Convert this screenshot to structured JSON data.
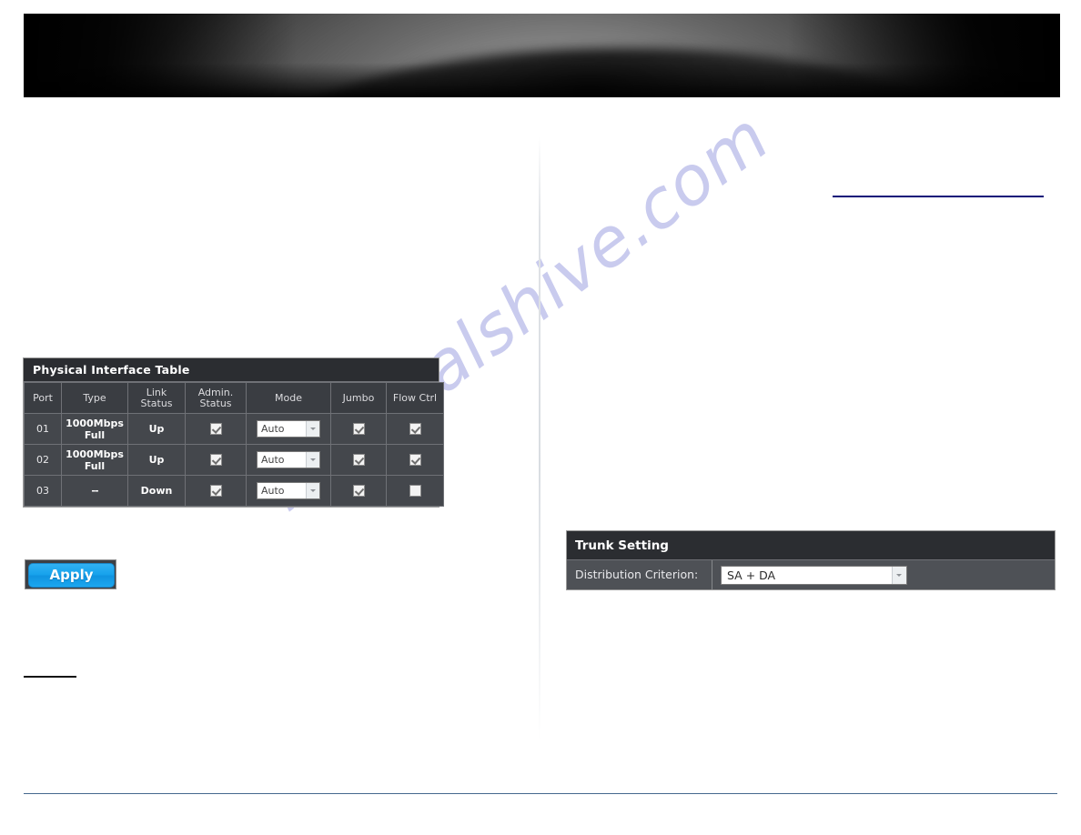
{
  "banner": {
    "name": "header-banner",
    "description": "dark abstract swoosh banner"
  },
  "watermark": {
    "text": "manualshive.com"
  },
  "physical_interface_table": {
    "title": "Physical Interface Table",
    "columns": [
      "Port",
      "Type",
      "Link Status",
      "Admin. Status",
      "Mode",
      "Jumbo",
      "Flow Ctrl"
    ],
    "column_lines": [
      [
        "Port"
      ],
      [
        "Type"
      ],
      [
        "Link",
        "Status"
      ],
      [
        "Admin.",
        "Status"
      ],
      [
        "Mode"
      ],
      [
        "Jumbo"
      ],
      [
        "Flow Ctrl"
      ]
    ],
    "rows": [
      {
        "port": "01",
        "type_line1": "1000Mbps",
        "type_line2": "Full",
        "link_status": "Up",
        "admin_status_checked": true,
        "mode": "Auto",
        "jumbo_checked": true,
        "flow_ctrl_checked": true
      },
      {
        "port": "02",
        "type_line1": "1000Mbps",
        "type_line2": "Full",
        "link_status": "Up",
        "admin_status_checked": true,
        "mode": "Auto",
        "jumbo_checked": true,
        "flow_ctrl_checked": true
      },
      {
        "port": "03",
        "type_line1": "--",
        "type_line2": "",
        "link_status": "Down",
        "admin_status_checked": true,
        "mode": "Auto",
        "jumbo_checked": true,
        "flow_ctrl_checked": false
      }
    ]
  },
  "apply": {
    "label": "Apply"
  },
  "trunk_setting": {
    "title": "Trunk Setting",
    "criterion_label": "Distribution Criterion:",
    "criterion_value": "SA + DA"
  },
  "colors": {
    "panel_header": "#2b2d31",
    "panel_body": "#44474c",
    "apply_blue": "#16a2ec",
    "link_navy": "#0d1179",
    "footer_rule": "#45688e",
    "watermark": "#c9cbee"
  }
}
